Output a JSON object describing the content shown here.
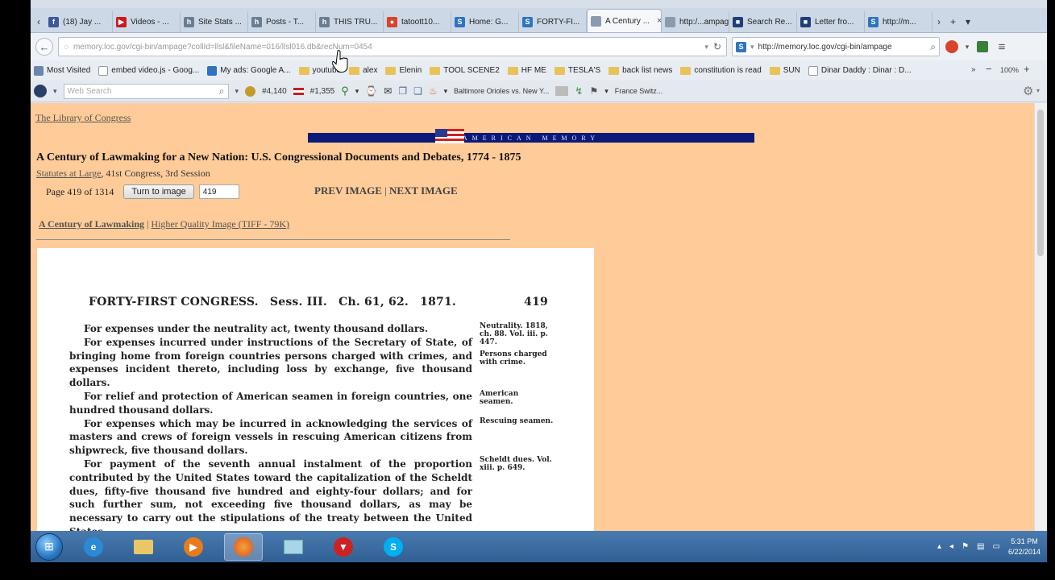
{
  "tabs": [
    {
      "label": "(18) Jay ...",
      "icon": "facebook-icon",
      "color": "#3b5998",
      "glyph": "f"
    },
    {
      "label": "Videos - ...",
      "icon": "youtube-icon",
      "color": "#cc181e",
      "glyph": "▶"
    },
    {
      "label": "Site Stats ...",
      "icon": "h-icon",
      "color": "#6b7d91",
      "glyph": "h"
    },
    {
      "label": "Posts - T...",
      "icon": "h-icon",
      "color": "#6b7d91",
      "glyph": "h"
    },
    {
      "label": "THIS TRU...",
      "icon": "h-icon",
      "color": "#6b7d91",
      "glyph": "h"
    },
    {
      "label": "tatoott10...",
      "icon": "stop-icon",
      "color": "#d9432c",
      "glyph": "●"
    },
    {
      "label": "Home: G...",
      "icon": "s-icon",
      "color": "#2f74c0",
      "glyph": "S"
    },
    {
      "label": "FORTY-FI...",
      "icon": "s-icon",
      "color": "#2f74c0",
      "glyph": "S"
    },
    {
      "label": "A Century ...",
      "icon": "page-icon",
      "color": "#8a9bb0",
      "glyph": "",
      "active": true
    },
    {
      "label": "http:/...ampage",
      "icon": "page-icon",
      "color": "#8a9bb0",
      "glyph": ""
    },
    {
      "label": "Search Re...",
      "icon": "loc-icon",
      "color": "#1f3f7a",
      "glyph": "■"
    },
    {
      "label": "Letter fro...",
      "icon": "loc-icon",
      "color": "#1f3f7a",
      "glyph": "■"
    },
    {
      "label": "http://m...",
      "icon": "s-icon",
      "color": "#2f74c0",
      "glyph": "S"
    }
  ],
  "tab_close": "×",
  "nav": {
    "url": "memory.loc.gov/cgi-bin/ampage?collId=llsl&fileName=016/llsl016.db&recNum=0454",
    "search_text": "http://memory.loc.gov/cgi-bin/ampage",
    "zoom": "100%"
  },
  "bookmarks": [
    {
      "label": "Most Visited",
      "kind": "gear"
    },
    {
      "label": "embed video.js - Goog...",
      "kind": "page"
    },
    {
      "label": "My ads: Google A...",
      "kind": "s"
    },
    {
      "label": "youtube",
      "kind": "folder"
    },
    {
      "label": "alex",
      "kind": "folder"
    },
    {
      "label": "Elenin",
      "kind": "folder"
    },
    {
      "label": "TOOL SCENE2",
      "kind": "folder"
    },
    {
      "label": "HF ME",
      "kind": "folder"
    },
    {
      "label": "TESLA'S",
      "kind": "folder"
    },
    {
      "label": "back list news",
      "kind": "folder"
    },
    {
      "label": "constitution is read",
      "kind": "folder"
    },
    {
      "label": "SUN",
      "kind": "folder"
    },
    {
      "label": "Dinar Daddy : Dinar : D...",
      "kind": "page"
    }
  ],
  "addon": {
    "search_placeholder": "Web Search",
    "rank1": "#4,140",
    "rank2": "#1,355",
    "link1": "Baltimore Orioles vs. New Y...",
    "link2": "France Switz..."
  },
  "page": {
    "loc_link": "The Library of Congress",
    "banner_text": "AMERICAN MEMORY",
    "heading": "A Century of Lawmaking for a New Nation: U.S. Congressional Documents and Debates, 1774 - 1875",
    "statutes_link": "Statutes at Large",
    "statutes_rest": ", 41st Congress, 3rd Session",
    "page_label": "Page 419 of 1314",
    "turn_button": "Turn to image",
    "page_input": "419",
    "prev": "PREV IMAGE",
    "sep": " | ",
    "next": "NEXT IMAGE",
    "century_link": "A Century of Lawmaking",
    "hq_link": "Higher Quality Image (TIFF - 79K)"
  },
  "scan": {
    "header_left": "FORTY-FIRST CONGRESS.",
    "header_sess": "Sess. III.",
    "header_ch": "Ch. 61, 62.",
    "header_year": "1871.",
    "header_page": "419",
    "paragraphs": [
      "For expenses under the neutrality act, twenty thousand dollars.",
      "For expenses incurred under instructions of the Secretary of State, of bringing home from foreign countries persons charged with crimes, and expenses incident thereto, including loss by exchange, five thousand dollars.",
      "For relief and protection of American seamen in foreign countries, one hundred thousand dollars.",
      "For expenses which may be incurred in acknowledging the services of masters and crews of foreign vessels in rescuing American citizens from shipwreck, five thousand dollars.",
      "For payment of the seventh annual instalment of the proportion contributed by the United States toward the capitalization of the Scheldt dues, fifty-five thousand five hundred and eighty-four dollars; and for such further sum, not exceeding five thousand dollars, as may be necessary to carry out the stipulations of the treaty between the United States"
    ],
    "notes": [
      "Neutrality. 1818, ch. 88. Vol. iii. p. 447.",
      "Persons charged with crime.",
      "American seamen.",
      "Rescuing seamen.",
      "Scheldt dues. Vol. xiii. p. 649."
    ]
  },
  "taskbar": {
    "time": "5:31 PM",
    "date": "6/22/2014"
  }
}
